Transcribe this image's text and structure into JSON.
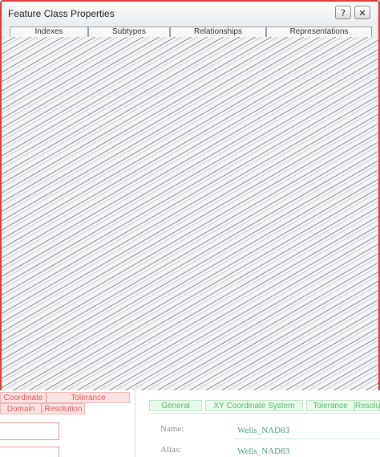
{
  "window": {
    "title": "Feature Class Properties",
    "help_label": "?",
    "close_label": "✕"
  },
  "tabs": [
    {
      "label": "Indexes"
    },
    {
      "label": "Subtypes"
    },
    {
      "label": "Relationships"
    },
    {
      "label": "Representations"
    }
  ],
  "background_dialog": {
    "left_tabs": [
      "Coordinate System",
      "Tolerance",
      "Domain",
      "Resolution"
    ],
    "right_tabs": [
      "General",
      "XY Coordinate System",
      "Tolerance",
      "Resolution"
    ],
    "fields": [
      {
        "label": "Name:",
        "value": "Wells_NAD83"
      },
      {
        "label": "Alias:",
        "value": "Wells_NAD83"
      }
    ]
  },
  "colors": {
    "window_border": "#e03a3a",
    "ghost_red": "#d85b5b",
    "ghost_green": "#55b86a"
  }
}
